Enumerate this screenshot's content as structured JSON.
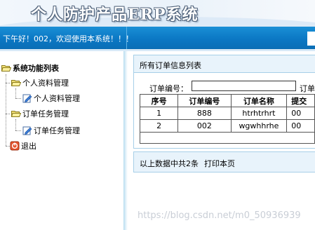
{
  "header": {
    "title": "个人防护产品ERP系统",
    "welcome": "下午好！002，欢迎使用本系统！！！"
  },
  "sidebar": {
    "root": "系统功能列表",
    "groups": [
      {
        "label": "个人资料管理",
        "items": [
          {
            "label": "个人资料管理"
          }
        ]
      },
      {
        "label": "订单任务管理",
        "items": [
          {
            "label": "订单任务管理"
          }
        ]
      }
    ],
    "logout": "退出"
  },
  "main": {
    "list_title": "所有订单信息列表",
    "search": {
      "label": "订单编号：",
      "value": "",
      "label_right": "订单"
    },
    "table": {
      "headers": [
        "序号",
        "订单编号",
        "订单名称",
        "提交"
      ],
      "rows": [
        [
          "1",
          "888",
          "htrhtrhrt",
          "00"
        ],
        [
          "2",
          "002",
          "wgwhhrhe",
          "00"
        ]
      ]
    },
    "summary": "以上数据中共2条",
    "print_link": "打印本页"
  },
  "watermark": "https://blog.csdn.net/m0_50936939",
  "colors": {
    "bar_blue": "#0b78c4",
    "panel_bg": "#e8f3fb",
    "panel_border": "#a7cfe8"
  },
  "icons": {
    "folder": "folder-open-icon",
    "page": "edit-page-icon",
    "logout": "logout-icon"
  }
}
